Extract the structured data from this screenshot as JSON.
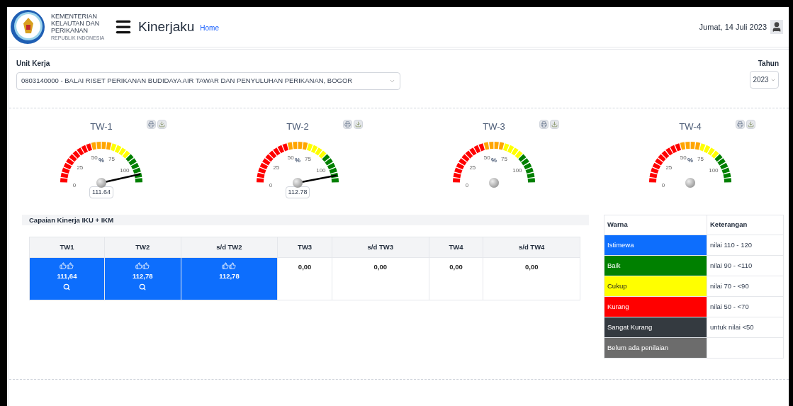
{
  "header": {
    "ministry_lines": [
      "KEMENTERIAN",
      "KELAUTAN DAN",
      "PERIKANAN"
    ],
    "ministry_subtitle": "REPUBLIK INDONESIA",
    "app_title": "Kinerjaku",
    "breadcrumb": "Home",
    "date": "Jumat, 14 Juli 2023"
  },
  "filters": {
    "unit_label": "Unit Kerja",
    "unit_value": "0803140000 - BALAI RISET PERIKANAN BUDIDAYA AIR TAWAR DAN PENYULUHAN PERIKANAN, BOGOR",
    "year_label": "Tahun",
    "year_value": "2023"
  },
  "gauges": [
    {
      "title": "TW-1",
      "ticks": [
        "0",
        "25",
        "50",
        "75",
        "100"
      ],
      "unit": "%",
      "reading": "111.64"
    },
    {
      "title": "TW-2",
      "ticks": [
        "0",
        "25",
        "50",
        "75",
        "100"
      ],
      "unit": "%",
      "reading": "112.78"
    },
    {
      "title": "TW-3",
      "ticks": [
        "0",
        "25",
        "50",
        "75",
        "100"
      ],
      "unit": "%"
    },
    {
      "title": "TW-4",
      "ticks": [
        "0",
        "25",
        "50",
        "75",
        "100"
      ],
      "unit": "%"
    }
  ],
  "performance": {
    "title": "Capaian Kinerja IKU + IKM",
    "columns": [
      "TW1",
      "TW2",
      "s/d TW2",
      "TW3",
      "s/d TW3",
      "TW4",
      "s/d TW4"
    ],
    "cells": [
      {
        "value": "111,64",
        "color": "#0d6efd",
        "thumbs": true,
        "magnifier": true
      },
      {
        "value": "112,78",
        "color": "#0d6efd",
        "thumbs": true,
        "magnifier": true
      },
      {
        "value": "112,78",
        "color": "#0d6efd",
        "thumbs": true,
        "magnifier": false
      },
      {
        "value": "0,00",
        "thumbs": false,
        "magnifier": false
      },
      {
        "value": "0,00",
        "thumbs": false,
        "magnifier": false
      },
      {
        "value": "0,00",
        "thumbs": false,
        "magnifier": false
      },
      {
        "value": "0,00",
        "thumbs": false,
        "magnifier": false
      }
    ]
  },
  "legend": {
    "columns": [
      "Warna",
      "Keterangan"
    ],
    "rows": [
      {
        "label": "Istimewa",
        "color": "#0d6efd",
        "description": "nilai 110 - 120"
      },
      {
        "label": "Baik",
        "color": "#008000",
        "description": "nilai 90 - <110"
      },
      {
        "label": "Cukup",
        "color": "#ffff00",
        "description": "nilai 70 - <90"
      },
      {
        "label": "Kurang",
        "color": "#ff0000",
        "description": "nilai 50 - <70"
      },
      {
        "label": "Sangat Kurang",
        "color": "#343a40",
        "description": "untuk nilai <50"
      },
      {
        "label": "Belum ada penilaian",
        "color": "#6c6c6c"
      }
    ]
  }
}
